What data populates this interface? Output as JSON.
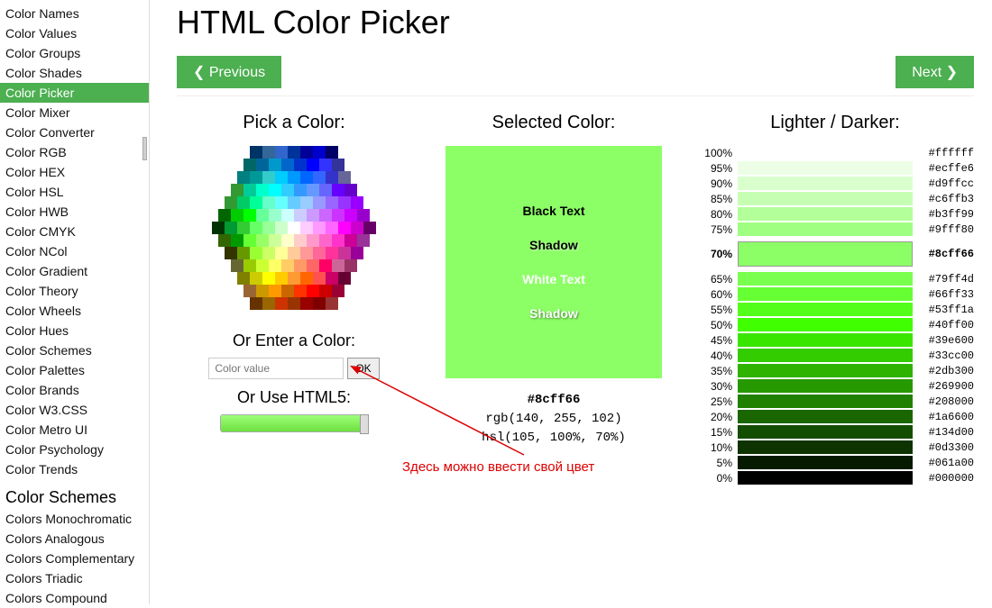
{
  "sidebar": {
    "items": [
      {
        "label": "Color Names",
        "active": false
      },
      {
        "label": "Color Values",
        "active": false
      },
      {
        "label": "Color Groups",
        "active": false
      },
      {
        "label": "Color Shades",
        "active": false
      },
      {
        "label": "Color Picker",
        "active": true
      },
      {
        "label": "Color Mixer",
        "active": false
      },
      {
        "label": "Color Converter",
        "active": false
      },
      {
        "label": "Color RGB",
        "active": false
      },
      {
        "label": "Color HEX",
        "active": false
      },
      {
        "label": "Color HSL",
        "active": false
      },
      {
        "label": "Color HWB",
        "active": false
      },
      {
        "label": "Color CMYK",
        "active": false
      },
      {
        "label": "Color NCol",
        "active": false
      },
      {
        "label": "Color Gradient",
        "active": false
      },
      {
        "label": "Color Theory",
        "active": false
      },
      {
        "label": "Color Wheels",
        "active": false
      },
      {
        "label": "Color Hues",
        "active": false
      },
      {
        "label": "Color Schemes",
        "active": false
      },
      {
        "label": "Color Palettes",
        "active": false
      },
      {
        "label": "Color Brands",
        "active": false
      },
      {
        "label": "Color W3.CSS",
        "active": false
      },
      {
        "label": "Color Metro UI",
        "active": false
      },
      {
        "label": "Color Psychology",
        "active": false
      },
      {
        "label": "Color Trends",
        "active": false
      }
    ],
    "heading": "Color Schemes",
    "schemes": [
      {
        "label": "Colors Monochromatic"
      },
      {
        "label": "Colors Analogous"
      },
      {
        "label": "Colors Complementary"
      },
      {
        "label": "Colors Triadic"
      },
      {
        "label": "Colors Compound"
      }
    ]
  },
  "page": {
    "title": "HTML Color Picker",
    "prev": "❮ Previous",
    "next": "Next ❯"
  },
  "picker": {
    "title": "Pick a Color:",
    "enter_title": "Or Enter a Color:",
    "placeholder": "Color value",
    "ok": "OK",
    "html5_title": "Or Use HTML5:"
  },
  "selected": {
    "title": "Selected Color:",
    "black_text": "Black Text",
    "shadow1": "Shadow",
    "white_text": "White Text",
    "shadow2": "Shadow",
    "hex": "#8cff66",
    "rgb": "rgb(140, 255, 102)",
    "hsl": "hsl(105, 100%, 70%)"
  },
  "shades": {
    "title": "Lighter / Darker:",
    "rows": [
      {
        "pct": "100%",
        "hex": "#ffffff",
        "color": "#ffffff"
      },
      {
        "pct": "95%",
        "hex": "#ecffe6",
        "color": "#ecffe6"
      },
      {
        "pct": "90%",
        "hex": "#d9ffcc",
        "color": "#d9ffcc"
      },
      {
        "pct": "85%",
        "hex": "#c6ffb3",
        "color": "#c6ffb3"
      },
      {
        "pct": "80%",
        "hex": "#b3ff99",
        "color": "#b3ff99"
      },
      {
        "pct": "75%",
        "hex": "#9fff80",
        "color": "#9fff80"
      },
      {
        "pct": "70%",
        "hex": "#8cff66",
        "color": "#8cff66",
        "current": true
      },
      {
        "pct": "65%",
        "hex": "#79ff4d",
        "color": "#79ff4d"
      },
      {
        "pct": "60%",
        "hex": "#66ff33",
        "color": "#66ff33"
      },
      {
        "pct": "55%",
        "hex": "#53ff1a",
        "color": "#53ff1a"
      },
      {
        "pct": "50%",
        "hex": "#40ff00",
        "color": "#40ff00"
      },
      {
        "pct": "45%",
        "hex": "#39e600",
        "color": "#39e600"
      },
      {
        "pct": "40%",
        "hex": "#33cc00",
        "color": "#33cc00"
      },
      {
        "pct": "35%",
        "hex": "#2db300",
        "color": "#2db300"
      },
      {
        "pct": "30%",
        "hex": "#269900",
        "color": "#269900"
      },
      {
        "pct": "25%",
        "hex": "#208000",
        "color": "#208000"
      },
      {
        "pct": "20%",
        "hex": "#1a6600",
        "color": "#1a6600"
      },
      {
        "pct": "15%",
        "hex": "#134d00",
        "color": "#134d00"
      },
      {
        "pct": "10%",
        "hex": "#0d3300",
        "color": "#0d3300"
      },
      {
        "pct": "5%",
        "hex": "#061a00",
        "color": "#061a00"
      },
      {
        "pct": "0%",
        "hex": "#000000",
        "color": "#000000"
      }
    ]
  },
  "annotation": {
    "text": "Здесь можно ввести свой цвет"
  },
  "hexwheel": [
    [
      "#003366",
      "#336699",
      "#3366CC",
      "#003399",
      "#000099",
      "#0000CC",
      "#000066"
    ],
    [
      "#006666",
      "#006699",
      "#0099CC",
      "#0066CC",
      "#0033CC",
      "#0000FF",
      "#3333FF",
      "#333399"
    ],
    [
      "#008080",
      "#009999",
      "#33CCCC",
      "#00CCFF",
      "#0099FF",
      "#0066FF",
      "#3366FF",
      "#3333CC",
      "#666699"
    ],
    [
      "#339933",
      "#00CC99",
      "#00FFCC",
      "#00FFFF",
      "#33CCFF",
      "#3399FF",
      "#6699FF",
      "#6666FF",
      "#6600FF",
      "#6600CC"
    ],
    [
      "#339933",
      "#00CC66",
      "#00FF99",
      "#66FFCC",
      "#66FFFF",
      "#66CCFF",
      "#99CCFF",
      "#9999FF",
      "#9966FF",
      "#9933FF",
      "#9900FF"
    ],
    [
      "#006600",
      "#00CC00",
      "#00FF00",
      "#66FF99",
      "#99FFCC",
      "#CCFFFF",
      "#CCCCFF",
      "#CC99FF",
      "#CC66FF",
      "#CC33FF",
      "#CC00FF",
      "#9900CC"
    ],
    [
      "#003300",
      "#009933",
      "#33CC33",
      "#66FF66",
      "#99FF99",
      "#CCFFCC",
      "#FFFFFF",
      "#FFCCFF",
      "#FF99FF",
      "#FF66FF",
      "#FF00FF",
      "#CC00CC",
      "#660066"
    ],
    [
      "#336600",
      "#009900",
      "#66FF33",
      "#99FF66",
      "#CCFF99",
      "#FFFFCC",
      "#FFCCCC",
      "#FF99CC",
      "#FF66CC",
      "#FF33CC",
      "#CC0099",
      "#993399"
    ],
    [
      "#333300",
      "#669900",
      "#99FF33",
      "#CCFF66",
      "#FFFF99",
      "#FFCC99",
      "#FF9999",
      "#FF6699",
      "#FF3399",
      "#CC3399",
      "#990099"
    ],
    [
      "#666633",
      "#99CC00",
      "#CCFF33",
      "#FFFF66",
      "#FFCC66",
      "#FF9966",
      "#FF6666",
      "#FF0066",
      "#CC6699",
      "#993366"
    ],
    [
      "#808000",
      "#CCCC00",
      "#FFFF00",
      "#FFCC00",
      "#FF9933",
      "#FF6600",
      "#FF5050",
      "#CC0066",
      "#660033"
    ],
    [
      "#996633",
      "#CC9900",
      "#FF9900",
      "#CC6600",
      "#FF3300",
      "#FF0000",
      "#CC0000",
      "#990033"
    ],
    [
      "#663300",
      "#996600",
      "#CC3300",
      "#993300",
      "#990000",
      "#800000",
      "#993333"
    ]
  ]
}
